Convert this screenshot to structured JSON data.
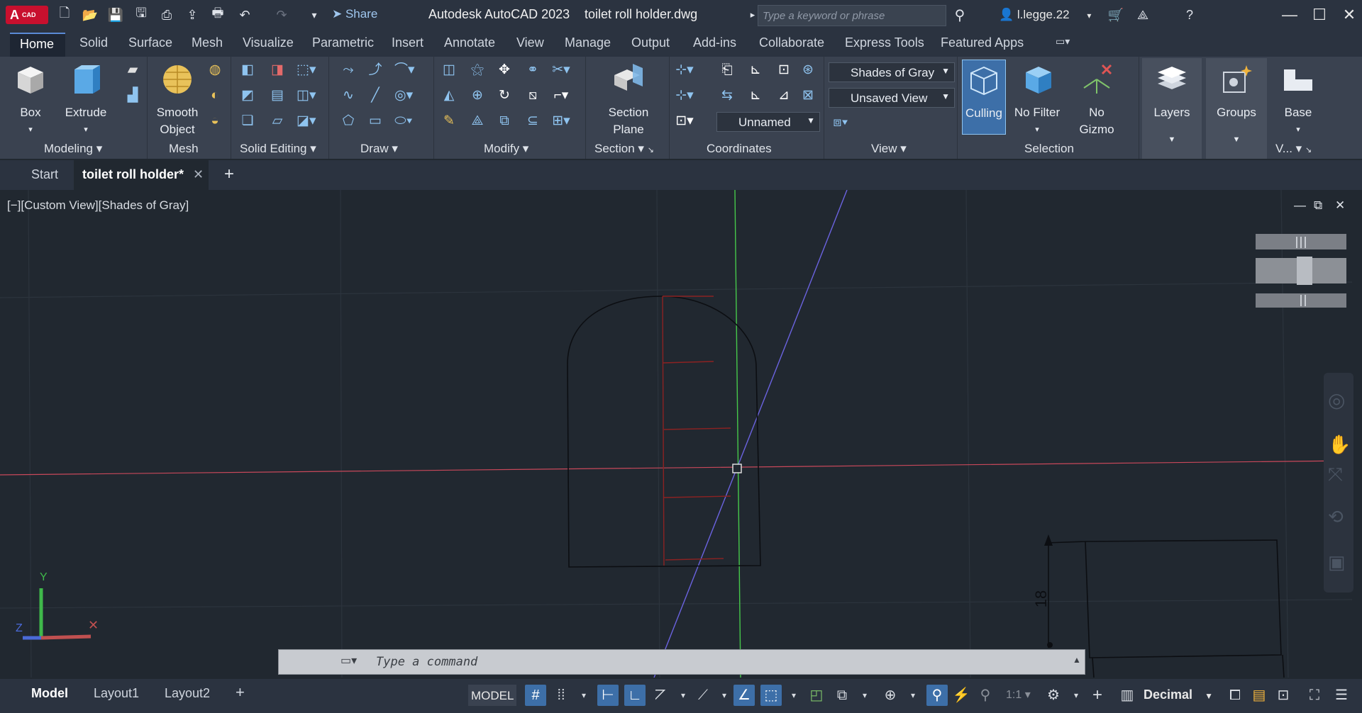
{
  "app": {
    "logo_main": "A",
    "logo_sub": "CAD",
    "title": "Autodesk AutoCAD 2023",
    "file": "toilet roll holder.dwg"
  },
  "qat": {
    "share_label": "Share"
  },
  "search": {
    "placeholder": "Type a keyword or phrase"
  },
  "user": {
    "name": "l.legge.22"
  },
  "menu": {
    "tabs": [
      "Home",
      "Solid",
      "Surface",
      "Mesh",
      "Visualize",
      "Parametric",
      "Insert",
      "Annotate",
      "View",
      "Manage",
      "Output",
      "Add-ins",
      "Collaborate",
      "Express Tools",
      "Featured Apps"
    ]
  },
  "ribbon": {
    "box": "Box",
    "extrude": "Extrude",
    "smooth1": "Smooth",
    "smooth2": "Object",
    "section1": "Section",
    "section2": "Plane",
    "culling": "Culling",
    "nofilter": "No Filter",
    "nogizmo1": "No",
    "nogizmo2": "Gizmo",
    "layers": "Layers",
    "groups": "Groups",
    "base": "Base",
    "visual_style": "Shades of Gray",
    "named_view": "Unsaved View",
    "ucs": "Unnamed",
    "panels": {
      "modeling": "Modeling",
      "mesh": "Mesh",
      "solid_editing": "Solid Editing",
      "draw": "Draw",
      "modify": "Modify",
      "section": "Section",
      "coordinates": "Coordinates",
      "view": "View",
      "selection": "Selection",
      "view_short": "V..."
    }
  },
  "filetabs": {
    "start": "Start",
    "active": "toilet roll holder*"
  },
  "viewport": {
    "label": "[−][Custom View][Shades of Gray]",
    "dimension": "18"
  },
  "command": {
    "placeholder": "Type a command"
  },
  "status": {
    "model_tab": "Model",
    "layout1": "Layout1",
    "layout2": "Layout2",
    "model": "MODEL",
    "scale": "1:1",
    "units": "Decimal"
  }
}
